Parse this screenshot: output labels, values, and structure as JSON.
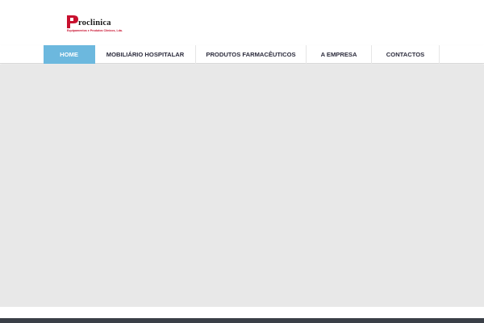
{
  "brand": {
    "name": "roclinica",
    "tagline": "Equipamentos e Produtos Clínicos, Lda.",
    "logo_icon": "red-p-mark-icon",
    "colors": {
      "primary": "#c8102e",
      "text": "#1a1a1a"
    }
  },
  "nav": {
    "active_color": "#6cb8de",
    "items": [
      {
        "label": "HOME",
        "active": true
      },
      {
        "label": "MOBILIÁRIO HOSPITALAR",
        "active": false
      },
      {
        "label": "PRODUTOS FARMACÊUTICOS",
        "active": false
      },
      {
        "label": "A EMPRESA",
        "active": false
      },
      {
        "label": "CONTACTOS",
        "active": false
      }
    ]
  },
  "hero": {
    "background": "#e8e8e8"
  },
  "footer": {
    "background": "#3a3f47"
  }
}
